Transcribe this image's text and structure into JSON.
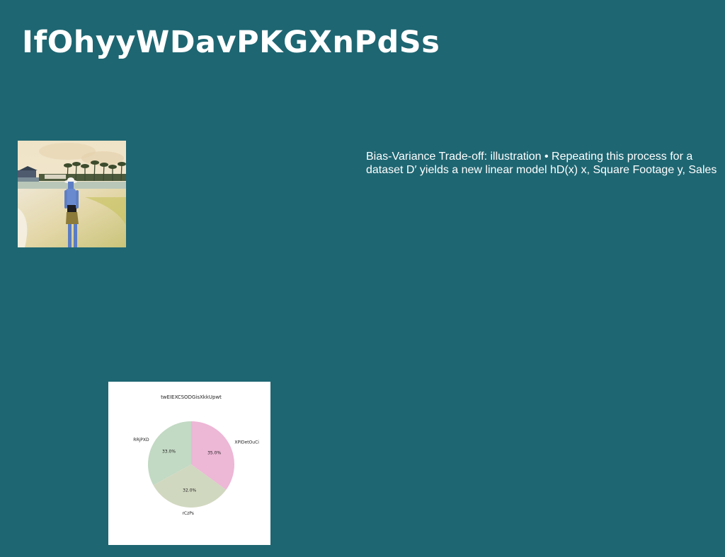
{
  "page": {
    "title": "IfOhyyWDavPKGXnPdSs",
    "caption": "Bias-Variance Trade-off: illustration • Repeating this process for a dataset D′ yields a new linear model hD(x) x, Square Footage y, Sales",
    "background_color": "#1e6672"
  },
  "photo": {
    "subject": "person-walking-on-beach"
  },
  "chart_data": {
    "type": "pie",
    "title": "twEIEXCSODGisXkkUpwt",
    "slices": [
      {
        "label": "XPIDetOuCi",
        "value": 35.0,
        "pct_label": "35.0%",
        "color": "#edb7d6"
      },
      {
        "label": "rCzPs",
        "value": 32.0,
        "pct_label": "32.0%",
        "color": "#d1d8c0"
      },
      {
        "label": "RRjPXD",
        "value": 33.0,
        "pct_label": "33.0%",
        "color": "#c2d9c3"
      }
    ]
  }
}
